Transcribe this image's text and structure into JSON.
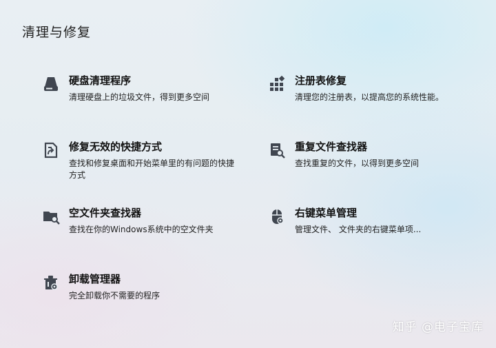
{
  "page": {
    "title": "清理与修复"
  },
  "tools": [
    {
      "name": "硬盘清理程序",
      "desc": "清理硬盘上的垃圾文件，得到更多空间",
      "icon": "disk-cleanup-icon"
    },
    {
      "name": "注册表修复",
      "desc": "清理您的注册表，以提高您的系统性能。",
      "icon": "registry-icon"
    },
    {
      "name": "修复无效的快捷方式",
      "desc": "查找和修复桌面和开始菜单里的有问题的快捷方式",
      "icon": "shortcut-repair-icon"
    },
    {
      "name": "重复文件查找器",
      "desc": "查找重复的文件，以得到更多空间",
      "icon": "duplicate-finder-icon"
    },
    {
      "name": "空文件夹查找器",
      "desc": "查找在你的Windows系统中的空文件夹",
      "icon": "empty-folder-icon"
    },
    {
      "name": "右键菜单管理",
      "desc": "管理文件、 文件夹的右键菜单项...",
      "icon": "context-menu-icon"
    },
    {
      "name": "卸载管理器",
      "desc": "完全卸载你不需要的程序",
      "icon": "uninstall-icon"
    }
  ],
  "watermark": "知乎 @电子宝库",
  "colors": {
    "icon": "#404650",
    "text": "#111111"
  }
}
